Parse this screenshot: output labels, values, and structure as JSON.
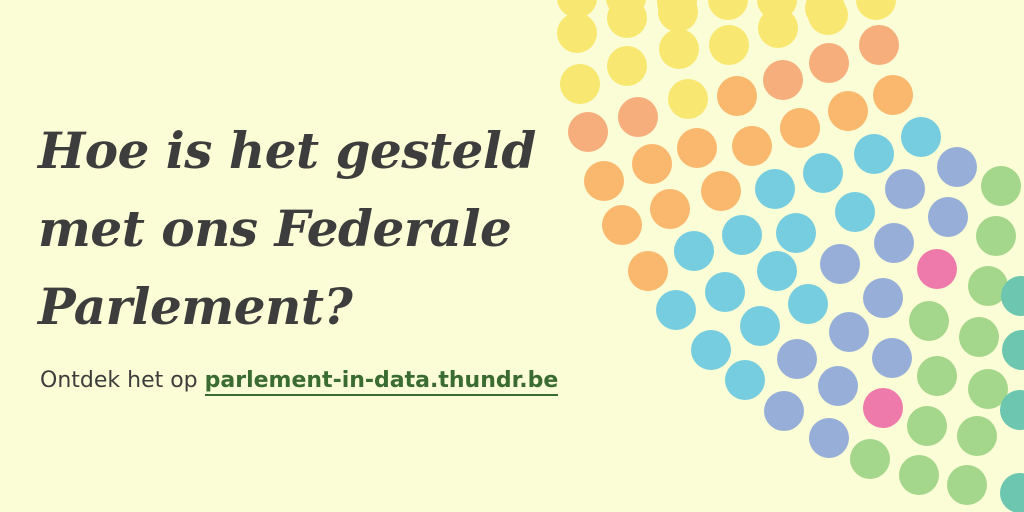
{
  "headline": "Hoe is het gesteld met ons Federale Parlement?",
  "cta": {
    "prefix": "Ontdek het op ",
    "link_text": "parlement-in-data.thundr.be"
  },
  "seat_colors": {
    "yellow": "#f8e872",
    "orange": "#fab76e",
    "salmon": "#f6ae7d",
    "blue": "#76cde0",
    "periwinkle": "#97afd8",
    "pink": "#ee7aab",
    "green": "#a4d78b",
    "teal": "#6cc6b0"
  }
}
